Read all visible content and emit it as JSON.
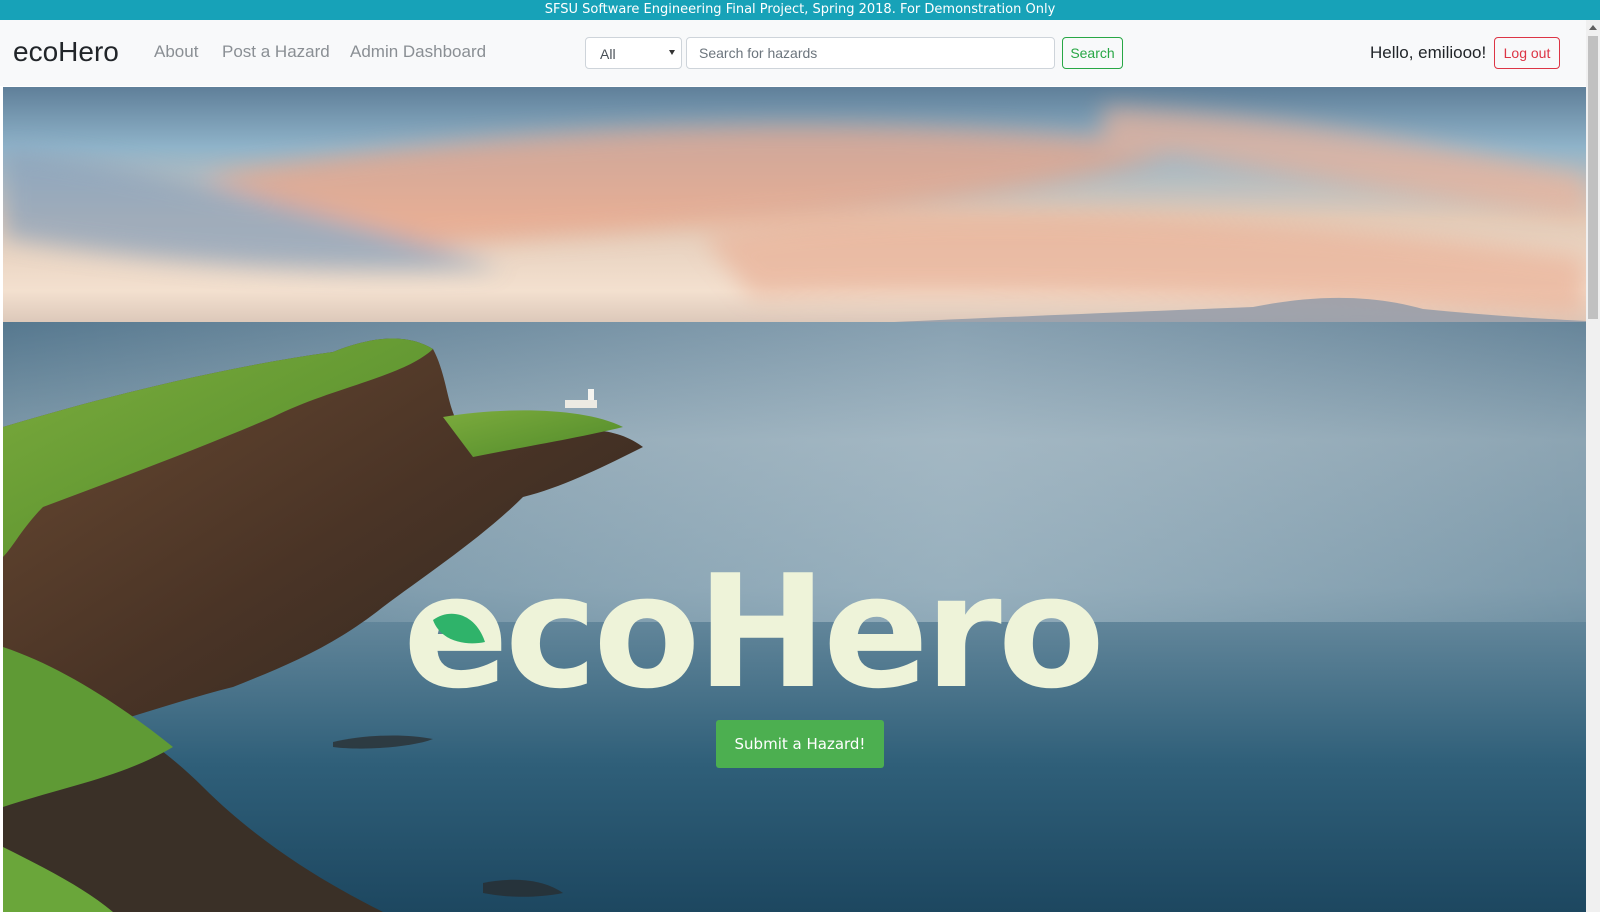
{
  "banner": {
    "text": "SFSU Software Engineering Final Project, Spring 2018. For Demonstration Only"
  },
  "navbar": {
    "brand": "ecoHero",
    "links": [
      {
        "label": "About"
      },
      {
        "label": "Post a Hazard"
      },
      {
        "label": "Admin Dashboard"
      }
    ],
    "search": {
      "category_selected": "All",
      "placeholder": "Search for hazards",
      "button_label": "Search"
    },
    "greeting": "Hello, emiliooo!",
    "logout_label": "Log out"
  },
  "hero": {
    "logo_text": "ecoHero",
    "logo_icon": "leaf-icon",
    "cta_label": "Submit a Hazard!",
    "background": "coastal-cliffs-lighthouse-photo"
  },
  "colors": {
    "banner_bg": "#17a2b8",
    "navbar_bg": "#f8f9fa",
    "search_button": "#28a745",
    "logout_button": "#dc3545",
    "cta_bg": "#4caf50",
    "logo_fill": "#eef3d9",
    "leaf": "#2fb36a"
  }
}
